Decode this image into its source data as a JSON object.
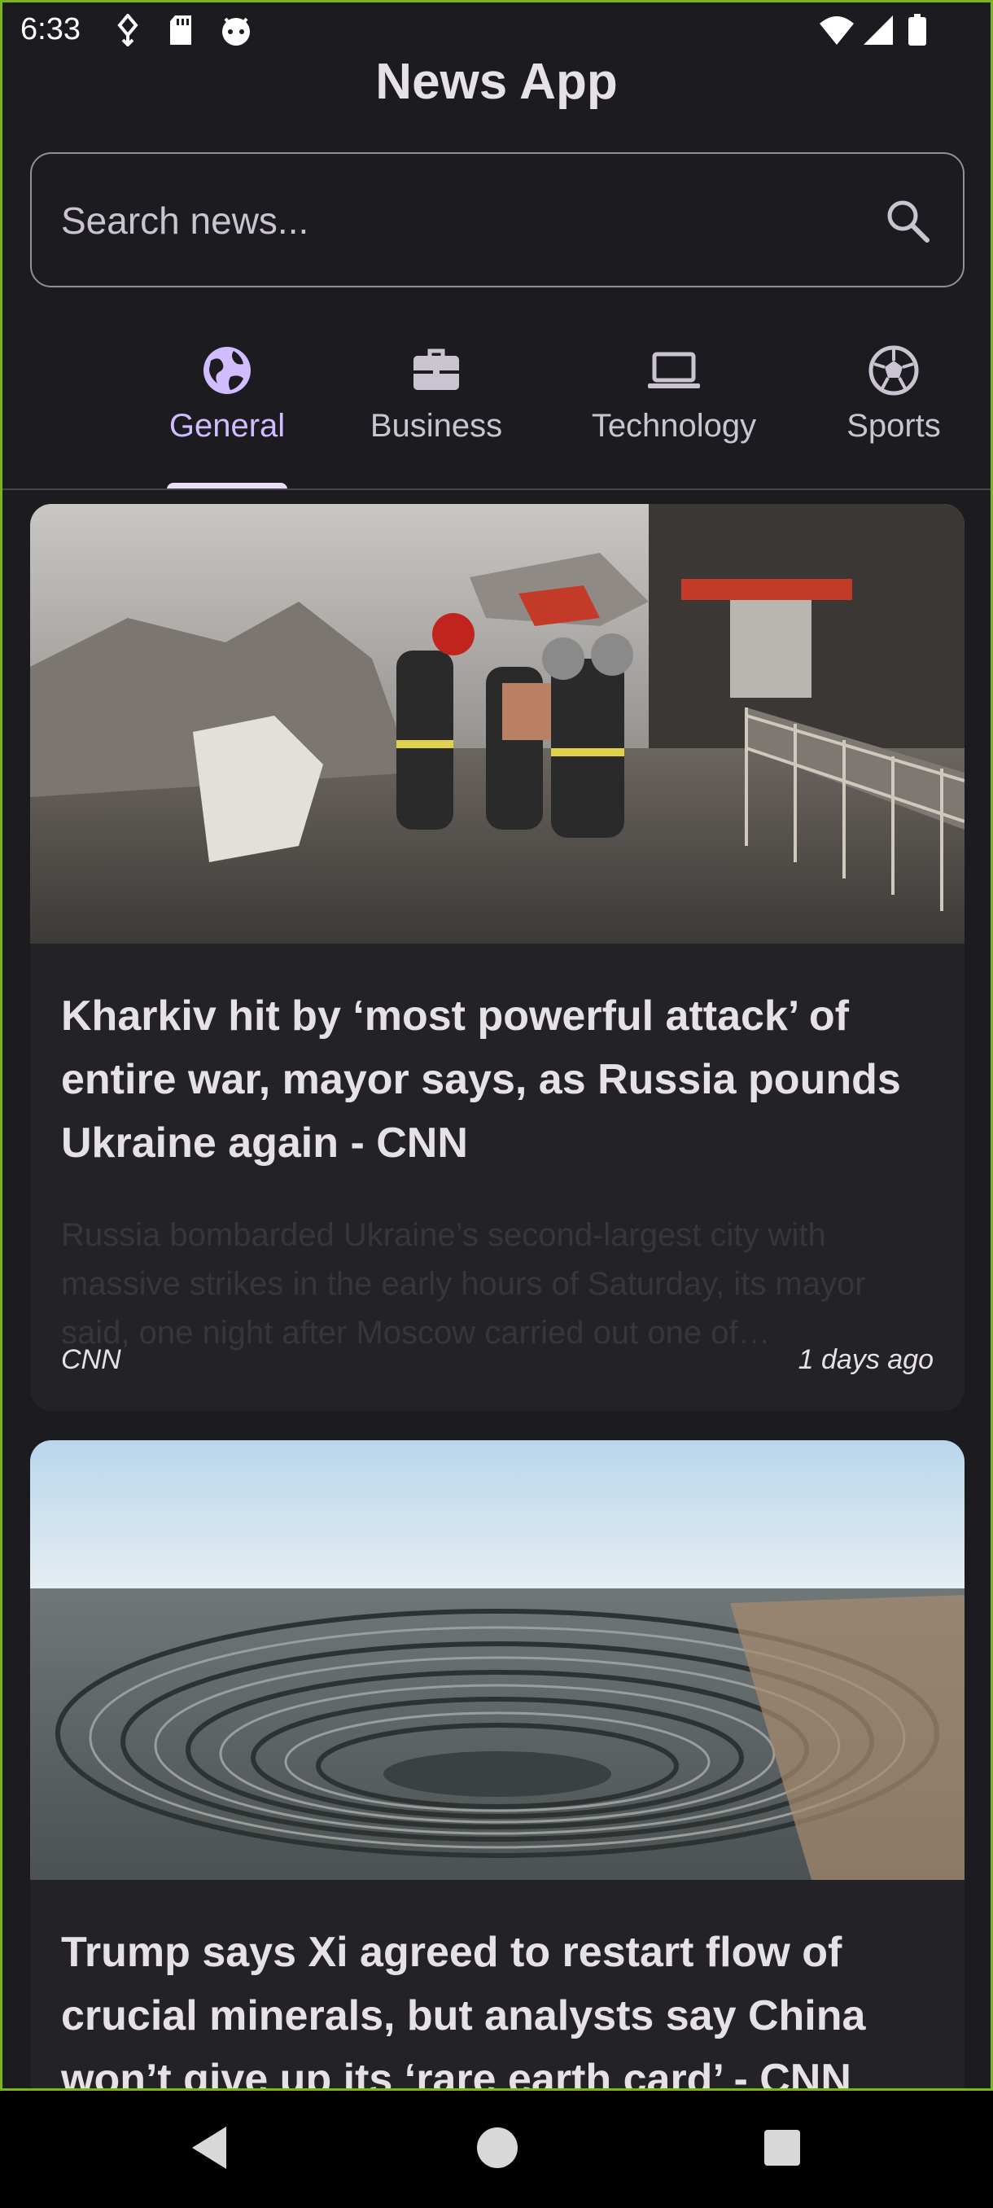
{
  "status_bar": {
    "time": "6:33",
    "icons": [
      "usb-debug-icon",
      "sd-card-icon",
      "android-icon",
      "wifi-icon",
      "signal-icon",
      "battery-icon"
    ]
  },
  "app": {
    "title": "News App"
  },
  "search": {
    "placeholder": "Search news..."
  },
  "tabs": [
    {
      "label": "General",
      "icon": "globe-icon",
      "active": true
    },
    {
      "label": "Business",
      "icon": "briefcase-icon",
      "active": false
    },
    {
      "label": "Technology",
      "icon": "laptop-icon",
      "active": false
    },
    {
      "label": "Sports",
      "icon": "soccer-ball-icon",
      "active": false
    }
  ],
  "articles": [
    {
      "title": "Kharkiv hit by ‘most powerful attack’ of entire war, mayor says, as Russia pounds Ukraine again - CNN",
      "description": "Russia bombarded Ukraine’s second-largest city with massive strikes in the early hours of Saturday, its mayor said, one night after Moscow carried out one of…",
      "source": "CNN",
      "age": "1 days ago"
    },
    {
      "title": "Trump says Xi agreed to restart flow of crucial minerals, but analysts say China won’t give up its ‘rare earth card’ - CNN",
      "description": "",
      "source": "",
      "age": ""
    }
  ],
  "nav_bar": {
    "buttons": [
      "back-button",
      "home-button",
      "recents-button"
    ]
  },
  "colors": {
    "background": "#1c1b1f",
    "card": "#232227",
    "accent": "#d0bcff",
    "frame": "#7cb518"
  }
}
